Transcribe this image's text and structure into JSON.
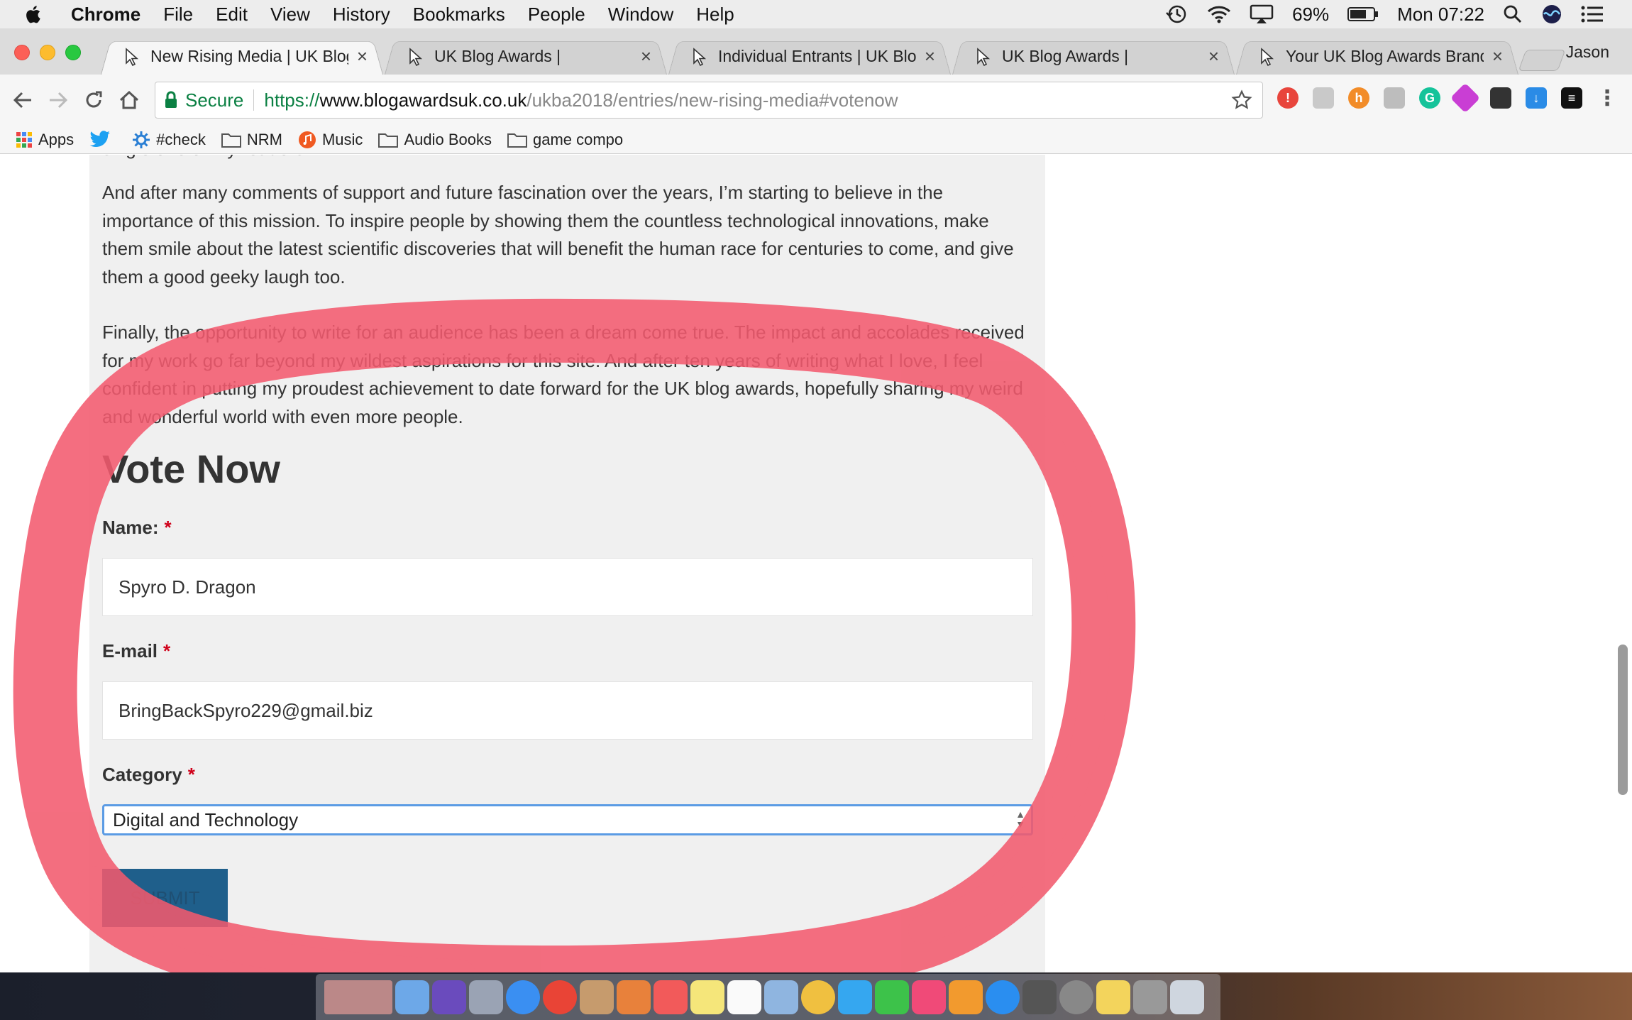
{
  "menubar": {
    "app": "Chrome",
    "items": [
      "File",
      "Edit",
      "View",
      "History",
      "Bookmarks",
      "People",
      "Window",
      "Help"
    ],
    "battery": "69%",
    "clock": "Mon 07:22"
  },
  "tabs": [
    {
      "title": "New Rising Media | UK Blog A",
      "active": true
    },
    {
      "title": "UK Blog Awards |",
      "active": false
    },
    {
      "title": "Individual Entrants | UK Blog A",
      "active": false
    },
    {
      "title": "UK Blog Awards |",
      "active": false
    },
    {
      "title": "Your UK Blog Awards Brandin",
      "active": false
    }
  ],
  "profile": "Jason",
  "address": {
    "secure_label": "Secure",
    "scheme": "https://",
    "host": "www.blogawardsuk.co.uk",
    "path": "/ukba2018/entries/new-rising-media#votenow"
  },
  "bookmarks": [
    {
      "label": "Apps",
      "icon": "apps-grid-icon"
    },
    {
      "label": "",
      "icon": "twitter-icon"
    },
    {
      "label": "#check",
      "icon": "gear-icon"
    },
    {
      "label": "NRM",
      "icon": "folder-icon"
    },
    {
      "label": "Music",
      "icon": "music-icon"
    },
    {
      "label": "Audio Books",
      "icon": "folder-icon"
    },
    {
      "label": "game compo",
      "icon": "folder-icon"
    }
  ],
  "article": {
    "cut_line": "single one of my readers.",
    "para1": "And after many comments of support and future fascination over the years, I’m starting to believe in the importance of this mission. To inspire people by showing them the countless technological innovations, make them smile about the latest scientific discoveries that will benefit the human race for centuries to come, and give them a good geeky laugh too.",
    "para2": "Finally, the opportunity to write for an audience has been a dream come true. The impact and accolades received for my work go far beyond my wildest aspirations for this site. And after ten years of writing what I love, I feel confident in putting my proudest achievement to date forward for the UK blog awards, hopefully sharing my weird and wonderful world with even more people."
  },
  "vote": {
    "title": "Vote Now",
    "required_mark": "*",
    "name_label": "Name:",
    "name_value": "Spyro D. Dragon",
    "email_label": "E-mail",
    "email_value": "BringBackSpyro229@gmail.biz",
    "category_label": "Category",
    "category_value": "Digital and Technology",
    "submit_label": "SUBMIT"
  },
  "colors": {
    "annotation": "#f25a6e",
    "submit_bg": "#1f5f8b",
    "select_focus": "#5b9be4",
    "secure_green": "#0b8043"
  }
}
